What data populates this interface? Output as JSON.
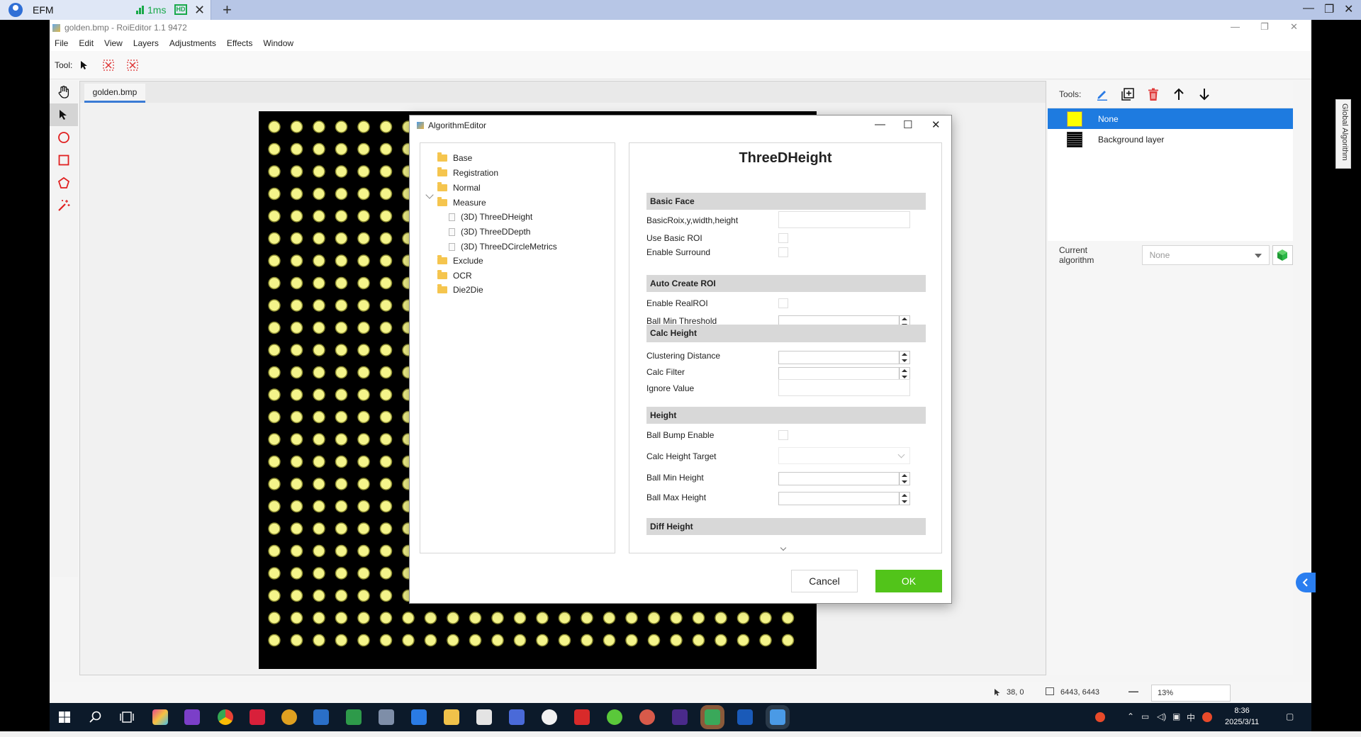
{
  "remote_viewer": {
    "tab_title": "EFM",
    "latency": "1ms",
    "quality_badge": "HD",
    "close_glyph": "✕",
    "new_tab_glyph": "+"
  },
  "window": {
    "title": "golden.bmp - RoiEditor 1.1 9472",
    "controls": {
      "minimize": "—",
      "restore": "❐",
      "close": "✕"
    }
  },
  "menu": [
    "File",
    "Edit",
    "View",
    "Layers",
    "Adjustments",
    "Effects",
    "Window"
  ],
  "toolbar": {
    "tool_label": "Tool:"
  },
  "left_tools": [
    "hand-icon",
    "pointer-icon",
    "circle-icon",
    "rectangle-icon",
    "polygon-icon",
    "magic-wand-icon"
  ],
  "document": {
    "tab_name": "golden.bmp"
  },
  "right_panel": {
    "tools_label": "Tools:",
    "tool_icons": [
      "pencil-icon",
      "add-layer-icon",
      "delete-icon",
      "arrow-up-icon",
      "arrow-down-icon"
    ],
    "layers": [
      {
        "name": "None",
        "selected": true
      },
      {
        "name": "Background layer",
        "selected": false
      }
    ],
    "current_algorithm_label": "Current algorithm",
    "current_algorithm_value": "None",
    "vertical_tab": "Global Algorithm"
  },
  "status": {
    "cursor_position": "38, 0",
    "image_size": "6443, 6443",
    "zoom": "13%",
    "zoom_out_glyph": "—"
  },
  "dialog": {
    "title": "AlgorithmEditor",
    "controls": {
      "minimize": "—",
      "maximize": "☐",
      "close": "✕"
    },
    "tree": [
      {
        "label": "Base",
        "kind": "folder"
      },
      {
        "label": "Registration",
        "kind": "folder"
      },
      {
        "label": "Normal",
        "kind": "folder"
      },
      {
        "label": "Measure",
        "kind": "folder",
        "expanded": true
      },
      {
        "label": "(3D) ThreeDHeight",
        "kind": "item"
      },
      {
        "label": "(3D) ThreeDDepth",
        "kind": "item"
      },
      {
        "label": "(3D) ThreeDCircleMetrics",
        "kind": "item"
      },
      {
        "label": "Exclude",
        "kind": "folder"
      },
      {
        "label": "OCR",
        "kind": "folder"
      },
      {
        "label": "Die2Die",
        "kind": "folder"
      }
    ],
    "algorithm_title": "ThreeDHeight",
    "sections": {
      "basic_face": "Basic Face",
      "auto_create_roi": "Auto Create ROI",
      "calc_height": "Calc Height",
      "height": "Height",
      "diff_height": "Diff Height"
    },
    "fields": {
      "basic_roi": "BasicRoix,y,width,height",
      "use_basic_roi": "Use Basic ROI",
      "enable_surround": "Enable Surround",
      "enable_real_roi": "Enable RealROI",
      "ball_min_threshold": "Ball Min Threshold",
      "clustering_distance": "Clustering Distance",
      "calc_filter": "Calc Filter",
      "ignore_value": "Ignore Value",
      "ball_bump_enable": "Ball Bump Enable",
      "calc_height_target": "Calc Height Target",
      "ball_min_height": "Ball Min Height",
      "ball_max_height": "Ball Max Height"
    },
    "cancel_label": "Cancel",
    "ok_label": "OK"
  },
  "taskbar": {
    "time": "8:36",
    "date": "2025/3/11",
    "ime_label": "中",
    "apps": [
      "start-icon",
      "search-icon",
      "task-view-icon",
      "app-icon",
      "visual-studio-icon",
      "chrome-icon",
      "app-icon",
      "app-icon",
      "app-icon",
      "app-icon",
      "app-icon",
      "app-icon",
      "app-icon",
      "explorer-icon",
      "app-icon",
      "app-icon",
      "app-icon",
      "wps-icon",
      "app-icon",
      "app-icon",
      "app-icon",
      "app-icon",
      "app-icon",
      "roieditor-icon"
    ]
  },
  "colors": {
    "accent_blue": "#1e7be0",
    "ok_green": "#52c41a",
    "delete_red": "#e03c3c",
    "ball_yellow": "#f4f48a",
    "taskbar": "#0c1a2a"
  }
}
